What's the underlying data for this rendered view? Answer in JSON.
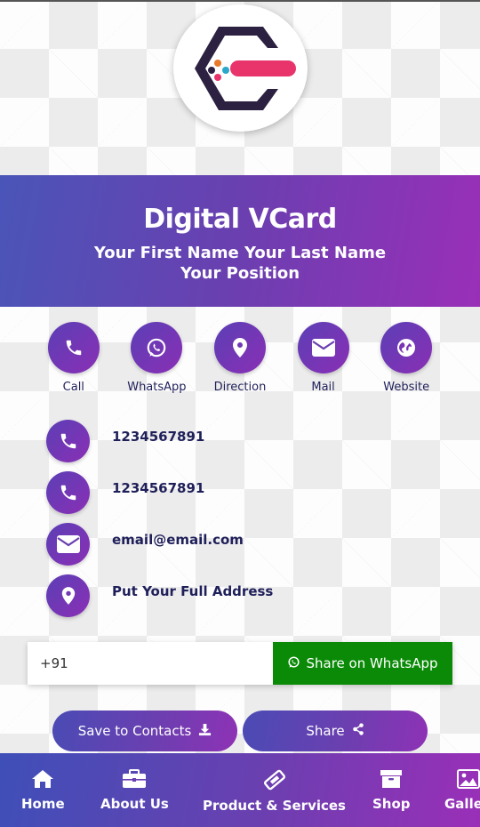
{
  "header": {
    "title": "Digital VCard",
    "name": "Your First Name Your Last Name",
    "position": "Your Position"
  },
  "actions": [
    {
      "label": "Call",
      "icon": "phone-icon"
    },
    {
      "label": "WhatsApp",
      "icon": "whatsapp-icon"
    },
    {
      "label": "Direction",
      "icon": "map-marker-icon"
    },
    {
      "label": "Mail",
      "icon": "envelope-icon"
    },
    {
      "label": "Website",
      "icon": "globe-icon"
    }
  ],
  "contacts": [
    {
      "text": "1234567891",
      "icon": "phone-icon"
    },
    {
      "text": "1234567891",
      "icon": "phone-icon"
    },
    {
      "text": "email@email.com",
      "icon": "envelope-icon"
    },
    {
      "text": "Put Your Full Address",
      "icon": "map-marker-icon"
    }
  ],
  "whatsapp_share": {
    "input_value": "+91",
    "button_label": "Share on WhatsApp"
  },
  "buttons": {
    "save_contacts": "Save to Contacts",
    "share": "Share"
  },
  "bottom_nav": [
    {
      "label": "Home",
      "icon": "home-icon"
    },
    {
      "label": "About Us",
      "icon": "briefcase-icon"
    },
    {
      "label": "Product & Services",
      "icon": "ticket-icon"
    },
    {
      "label": "Shop",
      "icon": "archive-box-icon"
    },
    {
      "label": "Gallery",
      "icon": "image-icon"
    }
  ],
  "colors": {
    "gradient_start": "#4a55b8",
    "gradient_end": "#9a2fb8",
    "whatsapp_green": "#0b8a08",
    "text_dark": "#1f1f5a"
  }
}
